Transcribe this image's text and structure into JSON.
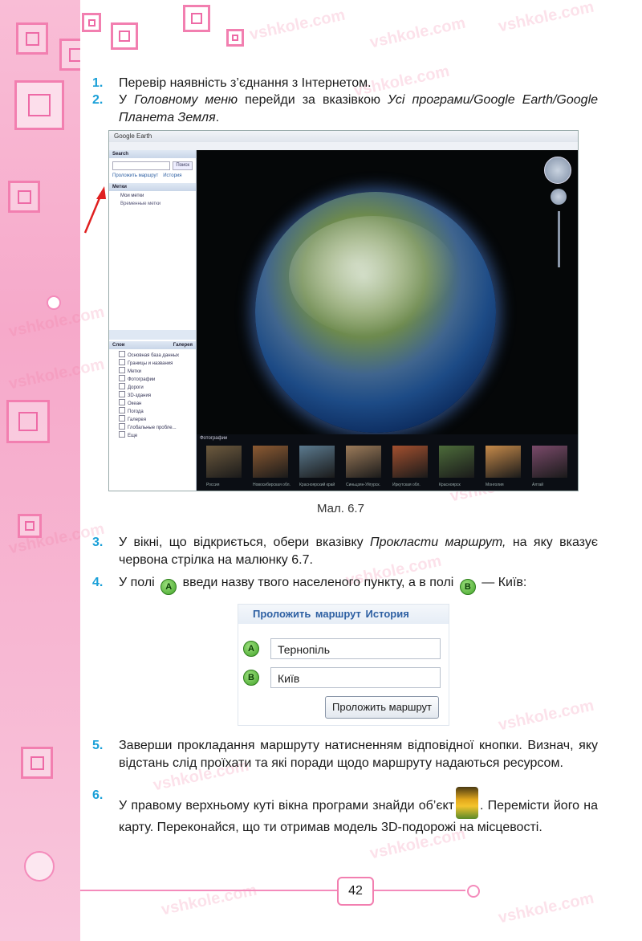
{
  "watermark": "vshkole.com",
  "steps": [
    {
      "num": "1.",
      "parts": [
        {
          "t": "Перевір наявність з’єднання з Інтернетом.",
          "i": false
        }
      ]
    },
    {
      "num": "2.",
      "parts": [
        {
          "t": "У ",
          "i": false
        },
        {
          "t": "Головному меню",
          "i": true
        },
        {
          "t": " перейди за вказівкою ",
          "i": false
        },
        {
          "t": "Усі програми/Google Earth/Google Планета Земля",
          "i": true
        },
        {
          "t": ".",
          "i": false
        }
      ]
    },
    {
      "num": "3.",
      "parts": [
        {
          "t": "У вікні, що відкриється, обери вказівку ",
          "i": false
        },
        {
          "t": "Прокласти маршрут,",
          "i": true
        },
        {
          "t": " на яку вказує червона стрілка на малюнку 6.7.",
          "i": false
        }
      ]
    },
    {
      "num": "4.",
      "before_a": "У полі",
      "after_a": "введи назву твого населеного пункту, а в полі",
      "after_b": "— Київ:"
    },
    {
      "num": "5.",
      "text": "Заверши прокладання маршруту натисненням відповідної кнопки. Визнач, яку відстань слід проїхати та які поради щодо маршруту надаються ресурсом."
    },
    {
      "num": "6.",
      "before_icon": "У правому верхньому куті вікна програми знайди об’єкт",
      "after_icon": ". Переміс­ти його на карту. Переконайся, що ти отримав модель 3D-подорожі на місцевості."
    }
  ],
  "figure": {
    "caption": "Мал. 6.7",
    "window_title": "Google Earth",
    "search_header": "Search",
    "search_button": "Поиск",
    "route_link": "Проложить маршрут",
    "history_link": "История",
    "places_header": "Метки",
    "my_places": "Мои метки",
    "temp_places": "Временные метки",
    "layers_header": "Слои",
    "gallery_button": "Галерея",
    "layers": [
      "Основная база данных",
      "Границы и названия",
      "Метки",
      "Фотографии",
      "Дороги",
      "3D-здания",
      "Океан",
      "Погода",
      "Галерея",
      "Глобальные пробле...",
      "Еще"
    ],
    "photos_header": "Фотографии",
    "photo_labels": [
      "Россия",
      "Новосибирская обл.",
      "Красноярский край",
      "Синьцзян-Уйгурск.",
      "Иркутская обл.",
      "Красноярск",
      "Монголия",
      "Алтай"
    ]
  },
  "badges": {
    "a": "A",
    "b": "B"
  },
  "route_panel": {
    "tab_route": "Проложить маршрут",
    "tab_history": "История",
    "field_a_value": "Тернопіль",
    "field_b_value": "Київ",
    "submit_label": "Проложить маршрут"
  },
  "page_number": "42",
  "colors": {
    "accent_blue": "#1aa0d8",
    "pink": "#f27fb0",
    "green_badge": "#43a52a"
  }
}
